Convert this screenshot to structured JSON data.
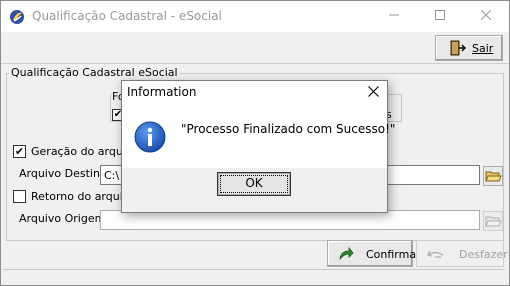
{
  "window": {
    "title": "Qualificação Cadastral - eSocial",
    "minimize_glyph": "─",
    "maximize_glyph": "☐",
    "close_glyph": "✕"
  },
  "toolbar": {
    "sair_label": "Sair"
  },
  "form": {
    "group_title": "Qualificação Cadastral eSocial",
    "inner_group_title": "Fo",
    "inner_group_suffix": "s",
    "geracao_label": "Geração do arquivo",
    "geracao_checked": true,
    "destino_label": "Arquivo Destino",
    "destino_value": "C:\\",
    "retorno_label": "Retorno do arquivo",
    "retorno_checked": false,
    "origem_label": "Arquivo Origem",
    "origem_value": ""
  },
  "actions": {
    "confirmar_label": "Confirmar",
    "desfazer_label": "Desfazer"
  },
  "dialog": {
    "title": "Information",
    "close_glyph": "✕",
    "message": "\"Processo Finalizado com Sucesso!\"",
    "ok_label": "OK",
    "icon": "information-icon"
  },
  "colors": {
    "info_icon": "#1b5fc9",
    "confirmar_arrow": "#2f8a2f"
  }
}
